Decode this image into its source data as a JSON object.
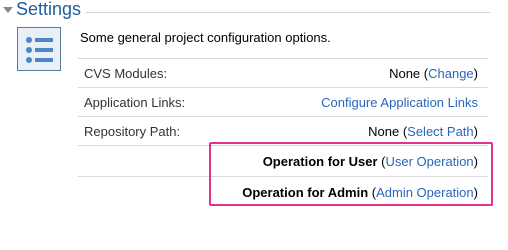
{
  "section": {
    "title": "Settings"
  },
  "description": "Some general project configuration options.",
  "rows": [
    {
      "label": "CVS Modules:",
      "value": "None",
      "link": "Change"
    },
    {
      "label": "Application Links:",
      "value": "",
      "link": "Configure Application Links"
    },
    {
      "label": "Repository Path:",
      "value": "None",
      "link": "Select Path"
    },
    {
      "label": "",
      "value": "Operation for User",
      "link": "User Operation"
    },
    {
      "label": "",
      "value": "Operation for Admin",
      "link": "Admin Operation"
    }
  ],
  "colors": {
    "title": "#1f5e99",
    "link": "#2a66b8",
    "highlight": "#e0338a"
  },
  "icons": {
    "settings": "list-settings-icon",
    "toggle": "collapse-triangle-icon"
  }
}
